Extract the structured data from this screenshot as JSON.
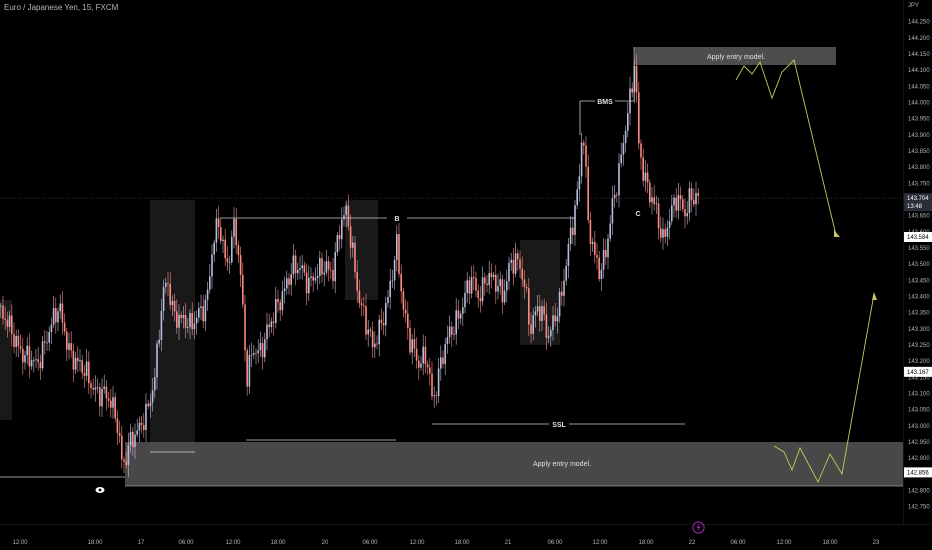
{
  "window": {
    "symbol_title": "Euro / Japanese Yen, 15, FXCM",
    "currency": "JPY"
  },
  "colors": {
    "background": "#000000",
    "up_candle": "#b7bedc",
    "down_candle": "#ff8a80",
    "zone_fill": "#555555",
    "projection_line": "#c8c85a",
    "drawing_line": "#cccccc",
    "grid_text": "#b2b5be"
  },
  "chart_data": {
    "type": "candlestick",
    "title": "Euro / Japanese Yen, 15, FXCM",
    "ylabel": "JPY",
    "ylim": [
      142.7,
      144.3
    ],
    "yticks": [
      "142.750",
      "142.800",
      "142.850",
      "142.900",
      "142.950",
      "143.000",
      "143.050",
      "143.100",
      "143.150",
      "143.200",
      "143.250",
      "143.300",
      "143.350",
      "143.400",
      "143.450",
      "143.500",
      "143.550",
      "143.600",
      "143.650",
      "143.700",
      "143.750",
      "143.800",
      "143.850",
      "143.900",
      "143.950",
      "144.000",
      "144.050",
      "144.100",
      "144.150",
      "144.200",
      "144.250"
    ],
    "xticks": [
      "12:00",
      "18:00",
      "17",
      "06:00",
      "12:00",
      "18:00",
      "20",
      "06:00",
      "12:00",
      "18:00",
      "21",
      "06:00",
      "12:00",
      "18:00",
      "22",
      "06:00",
      "12:00",
      "18:00",
      "23"
    ],
    "price_badges": [
      {
        "value": "143.704",
        "sub": "13:48",
        "style": "current"
      },
      {
        "value": "143.584",
        "style": "level"
      },
      {
        "value": "143.167",
        "style": "level"
      },
      {
        "value": "142.856",
        "style": "level"
      }
    ],
    "close_path": [
      [
        0,
        143.35
      ],
      [
        12,
        143.28
      ],
      [
        24,
        143.22
      ],
      [
        36,
        143.18
      ],
      [
        48,
        143.3
      ],
      [
        58,
        143.36
      ],
      [
        68,
        143.24
      ],
      [
        80,
        143.18
      ],
      [
        92,
        143.12
      ],
      [
        104,
        143.1
      ],
      [
        116,
        143.02
      ],
      [
        122,
        142.88
      ],
      [
        128,
        142.94
      ],
      [
        138,
        142.98
      ],
      [
        146,
        143.05
      ],
      [
        154,
        143.15
      ],
      [
        160,
        143.34
      ],
      [
        166,
        143.46
      ],
      [
        172,
        143.36
      ],
      [
        180,
        143.33
      ],
      [
        190,
        143.3
      ],
      [
        198,
        143.36
      ],
      [
        206,
        143.38
      ],
      [
        212,
        143.55
      ],
      [
        218,
        143.63
      ],
      [
        226,
        143.5
      ],
      [
        234,
        143.62
      ],
      [
        240,
        143.45
      ],
      [
        246,
        143.15
      ],
      [
        252,
        143.25
      ],
      [
        260,
        143.22
      ],
      [
        268,
        143.3
      ],
      [
        276,
        143.38
      ],
      [
        284,
        143.42
      ],
      [
        292,
        143.48
      ],
      [
        300,
        143.5
      ],
      [
        308,
        143.44
      ],
      [
        316,
        143.46
      ],
      [
        324,
        143.5
      ],
      [
        332,
        143.48
      ],
      [
        340,
        143.62
      ],
      [
        346,
        143.66
      ],
      [
        352,
        143.54
      ],
      [
        358,
        143.4
      ],
      [
        366,
        143.3
      ],
      [
        372,
        143.24
      ],
      [
        380,
        143.32
      ],
      [
        388,
        143.4
      ],
      [
        396,
        143.55
      ],
      [
        402,
        143.38
      ],
      [
        410,
        143.26
      ],
      [
        418,
        143.18
      ],
      [
        426,
        143.22
      ],
      [
        432,
        143.08
      ],
      [
        438,
        143.16
      ],
      [
        446,
        143.26
      ],
      [
        454,
        143.32
      ],
      [
        462,
        143.38
      ],
      [
        470,
        143.45
      ],
      [
        478,
        143.4
      ],
      [
        486,
        143.47
      ],
      [
        494,
        143.44
      ],
      [
        502,
        143.4
      ],
      [
        510,
        143.52
      ],
      [
        518,
        143.5
      ],
      [
        524,
        143.42
      ],
      [
        530,
        143.3
      ],
      [
        536,
        143.38
      ],
      [
        542,
        143.34
      ],
      [
        548,
        143.26
      ],
      [
        554,
        143.34
      ],
      [
        560,
        143.4
      ],
      [
        566,
        143.52
      ],
      [
        572,
        143.62
      ],
      [
        578,
        143.74
      ],
      [
        582,
        143.95
      ],
      [
        588,
        143.62
      ],
      [
        594,
        143.52
      ],
      [
        600,
        143.46
      ],
      [
        606,
        143.56
      ],
      [
        612,
        143.7
      ],
      [
        618,
        143.78
      ],
      [
        624,
        143.9
      ],
      [
        630,
        144.02
      ],
      [
        634,
        144.14
      ],
      [
        638,
        143.88
      ],
      [
        644,
        143.76
      ],
      [
        650,
        143.7
      ],
      [
        656,
        143.66
      ],
      [
        662,
        143.58
      ],
      [
        668,
        143.64
      ],
      [
        676,
        143.7
      ],
      [
        684,
        143.66
      ],
      [
        690,
        143.72
      ],
      [
        698,
        143.7
      ]
    ],
    "annotations": {
      "bms_label": "BMS",
      "b_label": "B",
      "c_label": "C",
      "ssl_label": "SSL",
      "upper_zone_label": "Apply entry model.",
      "lower_zone_label": "Apply entry model."
    }
  }
}
